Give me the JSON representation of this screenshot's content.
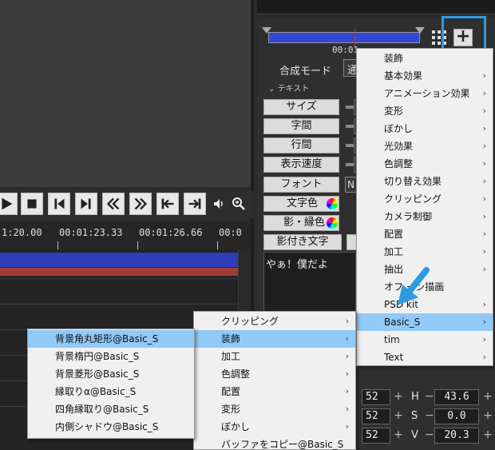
{
  "timeline": {
    "ruler_labels": [
      "1:20.00",
      "00:01:23.33",
      "00:01:26.66",
      "00:0"
    ]
  },
  "properties": {
    "time_display": "00:01:",
    "blend_mode_label": "合成モード",
    "blend_mode_value": "通",
    "section_title": "テキスト",
    "buttons": [
      "サイズ",
      "字間",
      "行間",
      "表示速度",
      "フォント",
      "文字色",
      "影・縁色",
      "影付き文字"
    ],
    "font_value": "N",
    "text_content": "やぁ！僕だよ"
  },
  "color_fields": {
    "rows": [
      {
        "num": "52",
        "label": "H",
        "value": "43.6"
      },
      {
        "num": "52",
        "label": "S",
        "value": "0.0"
      },
      {
        "num": "52",
        "label": "V",
        "value": "20.3"
      }
    ]
  },
  "menu_main": {
    "items": [
      {
        "label": "装飾",
        "arrow": ""
      },
      {
        "label": "基本効果",
        "arrow": "›"
      },
      {
        "label": "アニメーション効果",
        "arrow": "›"
      },
      {
        "label": "変形",
        "arrow": "›"
      },
      {
        "label": "ぼかし",
        "arrow": "›"
      },
      {
        "label": "光効果",
        "arrow": "›"
      },
      {
        "label": "色調整",
        "arrow": "›"
      },
      {
        "label": "切り替え効果",
        "arrow": "›"
      },
      {
        "label": "クリッピング",
        "arrow": "›"
      },
      {
        "label": "カメラ制御",
        "arrow": "›"
      },
      {
        "label": "配置",
        "arrow": "›"
      },
      {
        "label": "加工",
        "arrow": "›"
      },
      {
        "label": "抽出",
        "arrow": "›"
      },
      {
        "label": "オフ ーン描画",
        "arrow": ""
      },
      {
        "label": "PSD kit",
        "arrow": "›"
      },
      {
        "label": "Basic_S",
        "arrow": "›"
      },
      {
        "label": "tim",
        "arrow": "›"
      },
      {
        "label": "Text",
        "arrow": "›"
      }
    ]
  },
  "menu_basic_s": {
    "items": [
      {
        "label": "クリッピング",
        "arrow": "›"
      },
      {
        "label": "装飾",
        "arrow": "›"
      },
      {
        "label": "加工",
        "arrow": "›"
      },
      {
        "label": "色調整",
        "arrow": "›"
      },
      {
        "label": "配置",
        "arrow": "›"
      },
      {
        "label": "変形",
        "arrow": "›"
      },
      {
        "label": "ぼかし",
        "arrow": "›"
      },
      {
        "label": "バッファをコピー@Basic_S",
        "arrow": ""
      }
    ]
  },
  "menu_decoration": {
    "items": [
      {
        "label": "背景角丸矩形@Basic_S"
      },
      {
        "label": "背景楕円@Basic_S"
      },
      {
        "label": "背景菱形@Basic_S"
      },
      {
        "label": "縁取りα@Basic_S"
      },
      {
        "label": "四角縁取り@Basic_S"
      },
      {
        "label": "内側シャドウ@Basic_S"
      }
    ]
  },
  "colors": {
    "highlight": "#91c9f7",
    "annotation_blue": "#2e9be0",
    "clip_blue": "#2f3db8",
    "clip_red": "#a33a34"
  },
  "icons": [
    "play-icon",
    "stop-icon",
    "prev-frame-icon",
    "next-frame-icon",
    "rewind-icon",
    "fast-forward-icon",
    "jump-start-icon",
    "jump-end-icon",
    "volume-icon",
    "zoom-icon",
    "grid-icon",
    "plus-icon"
  ]
}
